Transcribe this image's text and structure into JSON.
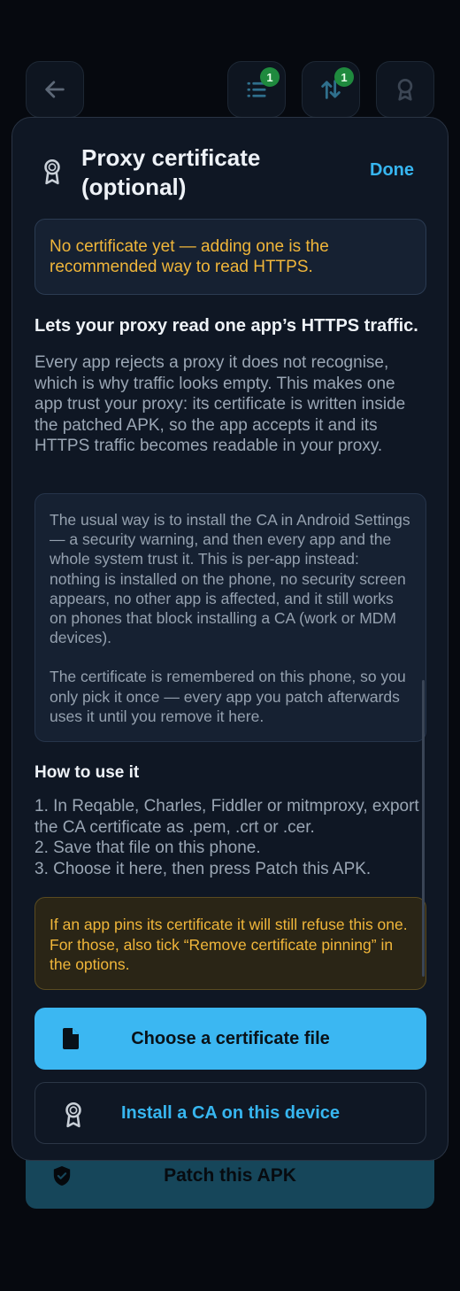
{
  "topbar": {
    "back_icon": "arrow-left-icon",
    "list_badge": "1",
    "transfer_badge": "1",
    "cert_icon": "certificate-icon"
  },
  "sheet": {
    "title": "Proxy certificate (optional)",
    "done_label": "Done",
    "notice": "No certificate yet — adding one is the recommended way to read HTTPS.",
    "lead": "Lets your proxy read one app’s HTTPS traffic.",
    "paragraph": "Every app rejects a proxy it does not recognise, which is why traffic looks empty. This makes one app trust your proxy: its certificate is written inside the patched APK, so the app accepts it and its HTTPS traffic becomes readable in your proxy.",
    "info_p1": "The usual way is to install the CA in Android Settings — a security warning, and then every app and the whole system trust it. This is per-app instead: nothing is installed on the phone, no security screen appears, no other app is affected, and it still works on phones that block installing a CA (work or MDM devices).",
    "info_p2": "The certificate is remembered on this phone, so you only pick it once — every app you patch afterwards uses it until you remove it here.",
    "howto_heading": "How to use it",
    "steps": [
      "1. In Reqable, Charles, Fiddler or mitmproxy, export the CA certificate as .pem, .crt or .cer.",
      "2. Save that file on this phone.",
      "3. Choose it here, then press Patch this APK."
    ],
    "warning": "If an app pins its certificate it will still refuse this one. For those, also tick “Remove certificate pinning” in the options.",
    "choose_label": "Choose a certificate file",
    "install_label": "Install a CA on this device"
  },
  "patch_button_label": "Patch this APK",
  "colors": {
    "accent": "#3bb7f2",
    "warning": "#f0b63a",
    "badge": "#1f8a3e"
  }
}
